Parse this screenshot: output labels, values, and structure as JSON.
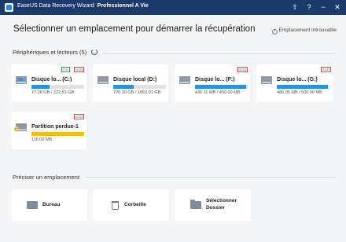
{
  "titlebar": {
    "app_name": "EaseUS Data Recovery Wizard",
    "edition": "Professionnel A Vie",
    "buttons": [
      "export-icon",
      "help-icon",
      "minimize-icon",
      "close-icon"
    ]
  },
  "main": {
    "heading": "Sélectionner un emplacement pour démarrer la récupération",
    "locate_link": "Emplacement introuvable"
  },
  "devices": {
    "label": "Périphériques et lecteurs (5)",
    "drives": [
      {
        "name": "Disque lo...  (C:)",
        "size": "77.38 GB / 222.53 GB",
        "fill": 0.35,
        "badges": [
          "OS",
          "SSD"
        ],
        "icon": "windows-drive-icon"
      },
      {
        "name": "Disque local (D:)",
        "size": "720.30 GB / 1863.01 GB",
        "fill": 0.39,
        "badges": [],
        "icon": "hard-drive-icon"
      },
      {
        "name": "Disque lo...  (F:)",
        "size": "436.11 MB / 450.00 MB",
        "fill": 0.97,
        "badges": [
          "SSD"
        ],
        "icon": "hard-drive-icon"
      },
      {
        "name": "Disque lo...  (G:)",
        "size": "486.05 MB / 500.00 MB",
        "fill": 0.97,
        "badges": [
          "SSD"
        ],
        "icon": "hard-drive-icon"
      },
      {
        "name": "Partition perdue-1",
        "size": "116.00 MB",
        "fill": 1.0,
        "badges": [
          "SSD"
        ],
        "icon": "lost-partition-icon",
        "color": "#f2c10f"
      }
    ]
  },
  "locations": {
    "label": "Préciser un emplacement",
    "items": [
      {
        "label": "Bureau",
        "icon": "desktop-icon"
      },
      {
        "label": "Corbeille",
        "icon": "recycle-bin-icon"
      },
      {
        "label_line1": "Sélectionner",
        "label_line2": "Dossier",
        "icon": "folder-icon"
      }
    ]
  },
  "colors": {
    "titlebar": "#1c3a6b",
    "accent": "#2a8fe0",
    "warning": "#f2c10f",
    "os_badge": "#2aa24a",
    "ssd_badge": "#e04a2f"
  }
}
